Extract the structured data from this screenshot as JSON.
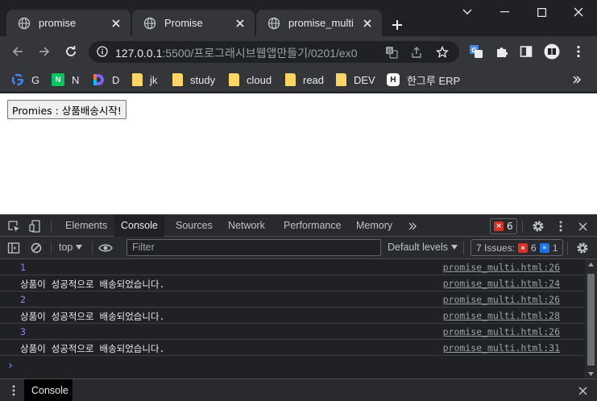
{
  "tabs": [
    {
      "title": "promise",
      "active": false
    },
    {
      "title": "Promise",
      "active": false
    },
    {
      "title": "promise_multi",
      "active": true
    }
  ],
  "address": {
    "host": "127.0.0.1",
    "path": ":5500/프로그래시브웹앱만들기/0201/ex0..."
  },
  "bookmarks": [
    {
      "label": "G",
      "icon": "google-icon"
    },
    {
      "label": "N",
      "icon": "naver-icon"
    },
    {
      "label": "D",
      "icon": "d-logo-icon"
    },
    {
      "label": "jk",
      "icon": "folder-icon"
    },
    {
      "label": "study",
      "icon": "folder-icon"
    },
    {
      "label": "cloud",
      "icon": "folder-icon"
    },
    {
      "label": "read",
      "icon": "folder-icon"
    },
    {
      "label": "DEV",
      "icon": "folder-icon"
    },
    {
      "label": "한그루 ERP",
      "icon": "h-logo-icon"
    }
  ],
  "page": {
    "button_label": "Promies : 상품배송시작!"
  },
  "devtools": {
    "tabs": [
      "Elements",
      "Console",
      "Sources",
      "Network",
      "Performance",
      "Memory"
    ],
    "active_tab": "Console",
    "error_count": "6",
    "context": "top",
    "filter_placeholder": "Filter",
    "levels": "Default levels",
    "issues_label": "7 Issues:",
    "issues_errors": "6",
    "issues_info": "1",
    "logs": [
      {
        "msg": "1",
        "src": "promise_multi.html:26",
        "number": true
      },
      {
        "msg": "상품이 성공적으로 배송되었습니다.",
        "src": "promise_multi.html:24",
        "number": false
      },
      {
        "msg": "2",
        "src": "promise_multi.html:26",
        "number": true
      },
      {
        "msg": "상품이 성공적으로 배송되었습니다.",
        "src": "promise_multi.html:28",
        "number": false
      },
      {
        "msg": "3",
        "src": "promise_multi.html:26",
        "number": true
      },
      {
        "msg": "상품이 성공적으로 배송되었습니다.",
        "src": "promise_multi.html:31",
        "number": false
      }
    ],
    "prompt": "›",
    "drawer_tab": "Console"
  },
  "colors": {
    "accent_blue": "#4e8bf5",
    "error_red": "#d93025",
    "number_purple": "#9980ff"
  }
}
